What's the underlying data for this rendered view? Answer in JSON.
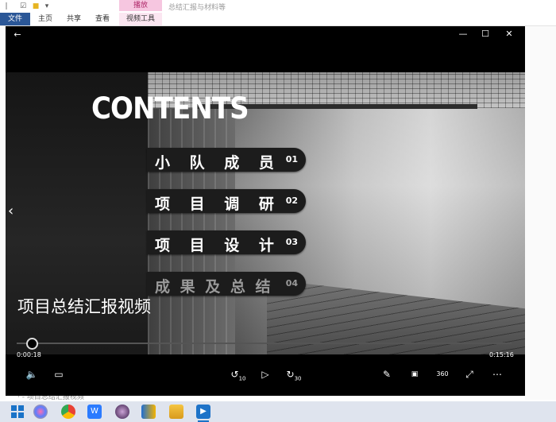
{
  "explorer": {
    "context_tab": "播放",
    "title": "总结汇报与材料等",
    "tabs": [
      "文件",
      "主页",
      "共享",
      "查看",
      "视频工具"
    ],
    "background_text": "· - 项目总结汇报视频"
  },
  "player": {
    "slide": {
      "heading": "CONTENTS",
      "items": [
        {
          "label": "小 队 成 员",
          "num": "01"
        },
        {
          "label": "项 目 调 研",
          "num": "02"
        },
        {
          "label": "项 目 设 计",
          "num": "03"
        },
        {
          "label": "成 果 及 总 结",
          "num": "04"
        }
      ]
    },
    "video_title": "项目总结汇报视频",
    "time_current": "0:00:18",
    "time_total": "0:15:16",
    "progress_fraction": 0.02,
    "skip_back": "10",
    "skip_fwd": "30",
    "icons": {
      "back": "back-arrow-icon",
      "minimize": "minimize-icon",
      "maximize": "maximize-icon",
      "close": "close-icon",
      "volume": "volume-icon",
      "subtitles": "subtitles-icon",
      "edit": "pencil-icon",
      "mini": "mini-view-icon",
      "rotate": "360-icon",
      "fullscreen": "fullscreen-icon",
      "more": "more-icon",
      "play": "play-icon"
    }
  },
  "accent": "#1a73c8"
}
